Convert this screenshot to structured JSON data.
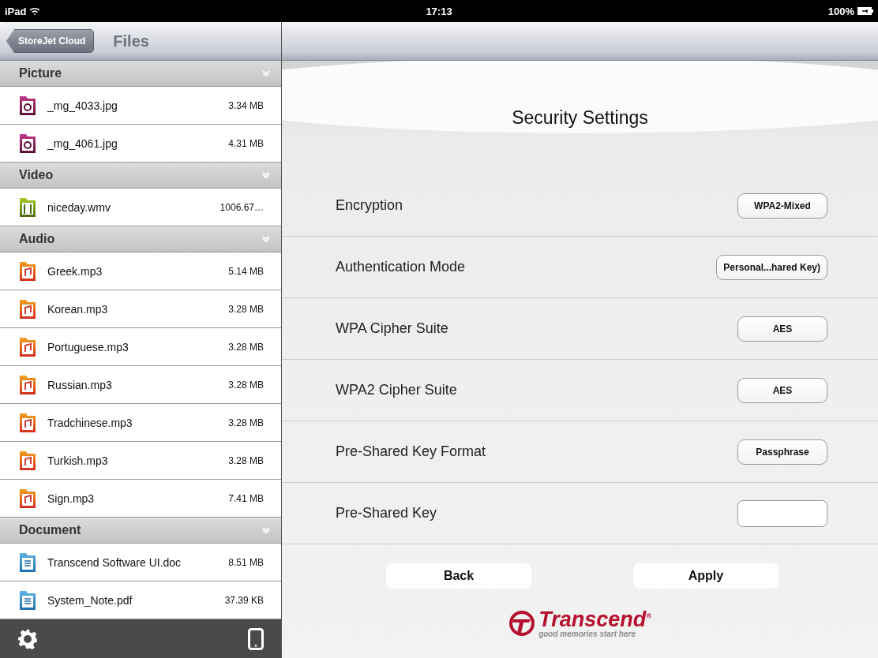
{
  "status_bar": {
    "carrier": "iPad",
    "time": "17:13",
    "battery": "100%"
  },
  "sidebar": {
    "back_button": "StoreJet Cloud",
    "title": "Files",
    "sections": [
      {
        "title": "Picture",
        "files": [
          {
            "name": "_mg_4033.jpg",
            "size": "3.34 MB",
            "kind": "picture"
          },
          {
            "name": "_mg_4061.jpg",
            "size": "4.31 MB",
            "kind": "picture"
          }
        ]
      },
      {
        "title": "Video",
        "files": [
          {
            "name": "niceday.wmv",
            "size": "1006.67…",
            "kind": "video"
          }
        ]
      },
      {
        "title": "Audio",
        "files": [
          {
            "name": "Greek.mp3",
            "size": "5.14 MB",
            "kind": "audio"
          },
          {
            "name": "Korean.mp3",
            "size": "3.28 MB",
            "kind": "audio"
          },
          {
            "name": "Portuguese.mp3",
            "size": "3.28 MB",
            "kind": "audio"
          },
          {
            "name": "Russian.mp3",
            "size": "3.28 MB",
            "kind": "audio"
          },
          {
            "name": "Tradchinese.mp3",
            "size": "3.28 MB",
            "kind": "audio"
          },
          {
            "name": "Turkish.mp3",
            "size": "3.28 MB",
            "kind": "audio"
          },
          {
            "name": "Sign.mp3",
            "size": "7.41 MB",
            "kind": "audio"
          }
        ]
      },
      {
        "title": "Document",
        "files": [
          {
            "name": "Transcend Software UI.doc",
            "size": "8.51 MB",
            "kind": "document"
          },
          {
            "name": "System_Note.pdf",
            "size": "37.39 KB",
            "kind": "document"
          }
        ]
      }
    ]
  },
  "settings": {
    "title": "Security Settings",
    "rows": [
      {
        "label": "Encryption",
        "kind": "select",
        "value": "WPA2-Mixed"
      },
      {
        "label": "Authentication Mode",
        "kind": "select",
        "value": "Personal...hared Key)"
      },
      {
        "label": "WPA Cipher Suite",
        "kind": "select",
        "value": "AES"
      },
      {
        "label": "WPA2 Cipher Suite",
        "kind": "select",
        "value": "AES"
      },
      {
        "label": "Pre-Shared Key Format",
        "kind": "select",
        "value": "Passphrase"
      },
      {
        "label": "Pre-Shared Key",
        "kind": "input"
      }
    ],
    "buttons": [
      "Back",
      "Apply"
    ]
  },
  "logo": {
    "name": "Transcend",
    "mark": "®",
    "tagline": "good memories start here"
  }
}
